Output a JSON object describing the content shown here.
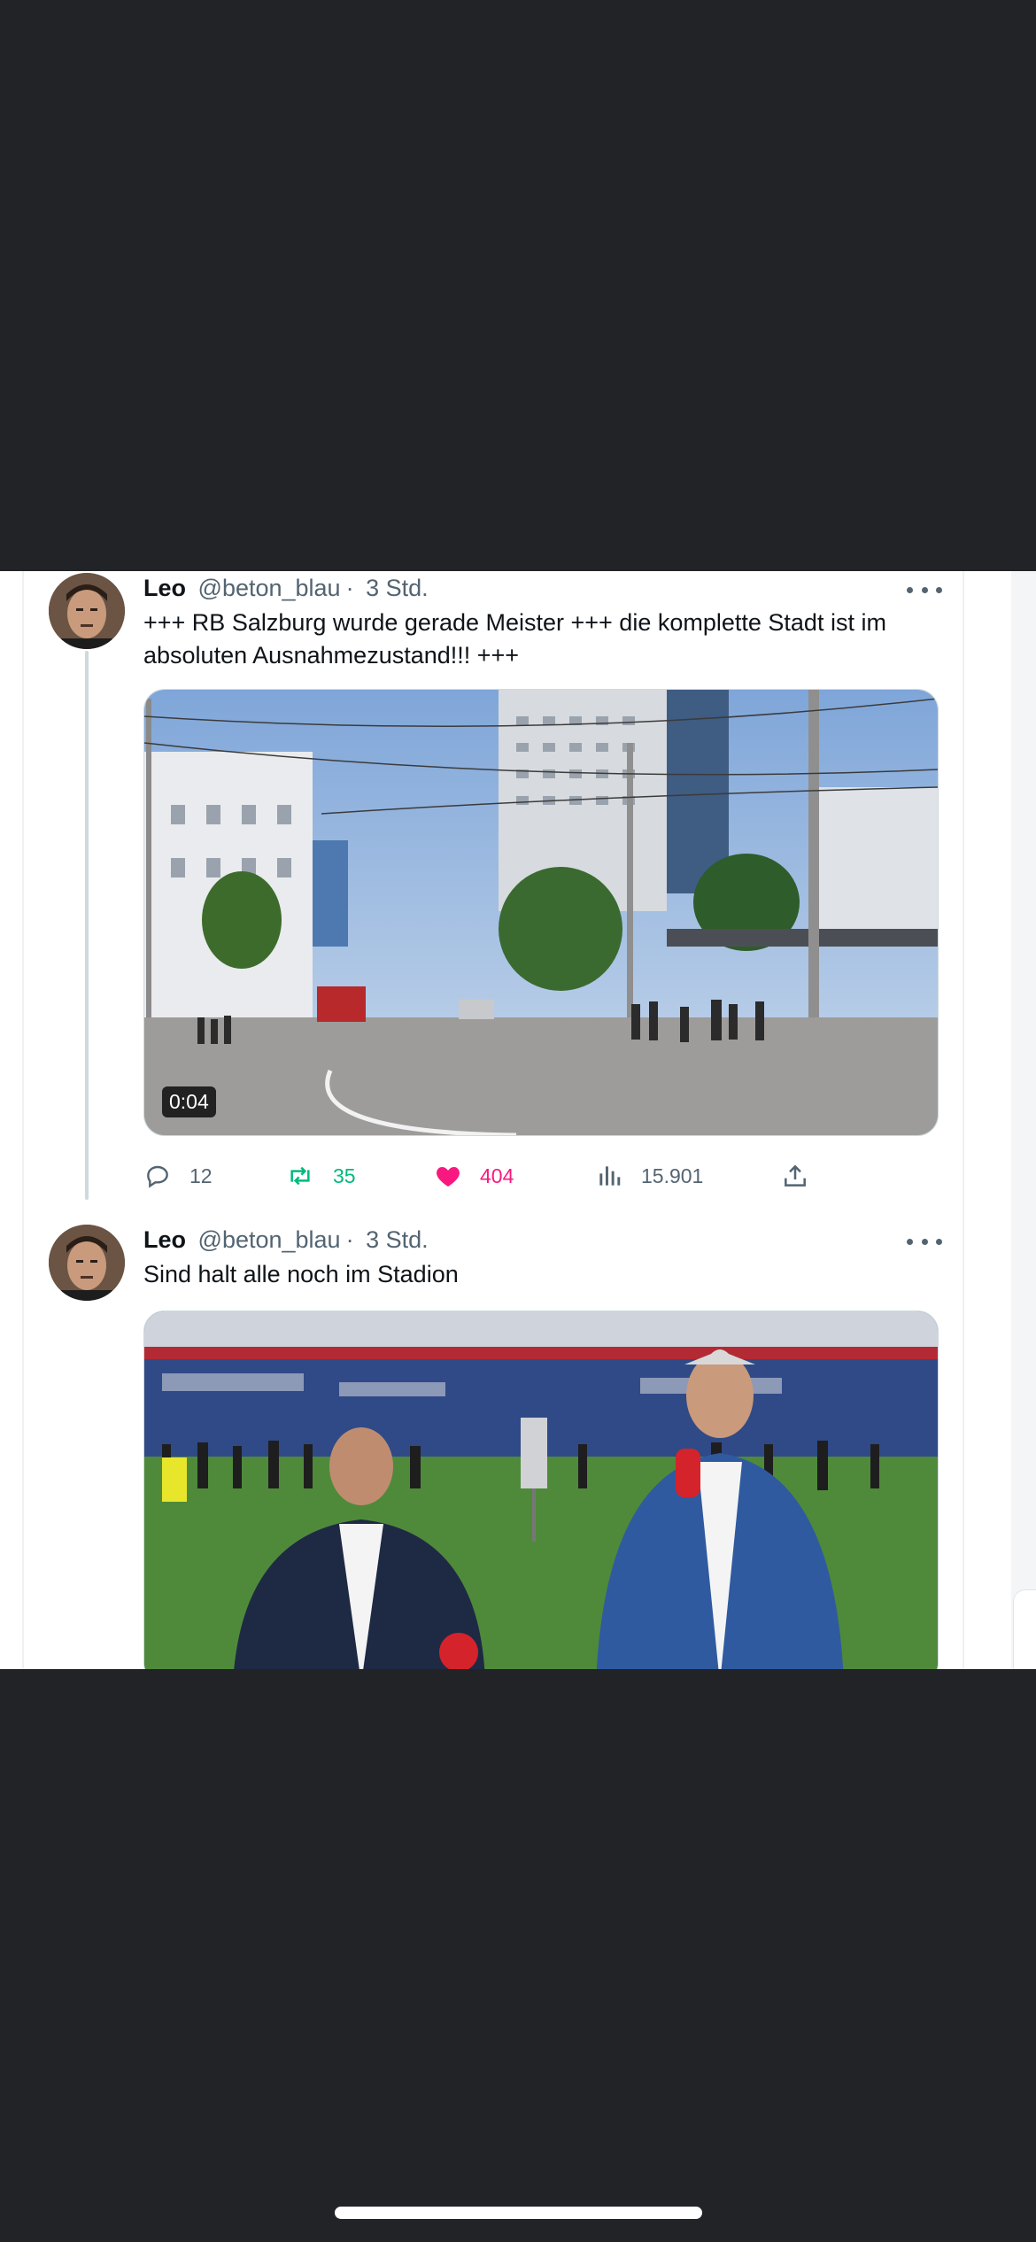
{
  "tweets": [
    {
      "author_name": "Leo",
      "handle": "@beton_blau",
      "separator": "·",
      "time": "3 Std.",
      "text": "+++ RB Salzburg wurde gerade Meister +++ die komplette Stadt ist im absoluten Ausnahmezustand!!! +++",
      "media": {
        "kind": "video",
        "duration": "0:04"
      },
      "actions": {
        "replies": "12",
        "retweets": "35",
        "likes": "404",
        "views": "15.901"
      }
    },
    {
      "author_name": "Leo",
      "handle": "@beton_blau",
      "separator": "·",
      "time": "3 Std.",
      "text": "Sind halt alle noch im Stadion",
      "media": {
        "kind": "image"
      }
    }
  ],
  "colors": {
    "background_dark": "#222326",
    "retweet_green": "#00ba7c",
    "like_pink": "#f91880",
    "secondary_text": "#536471"
  },
  "icons": [
    "reply-icon",
    "retweet-icon",
    "heart-icon",
    "views-icon",
    "share-icon",
    "more-icon"
  ]
}
